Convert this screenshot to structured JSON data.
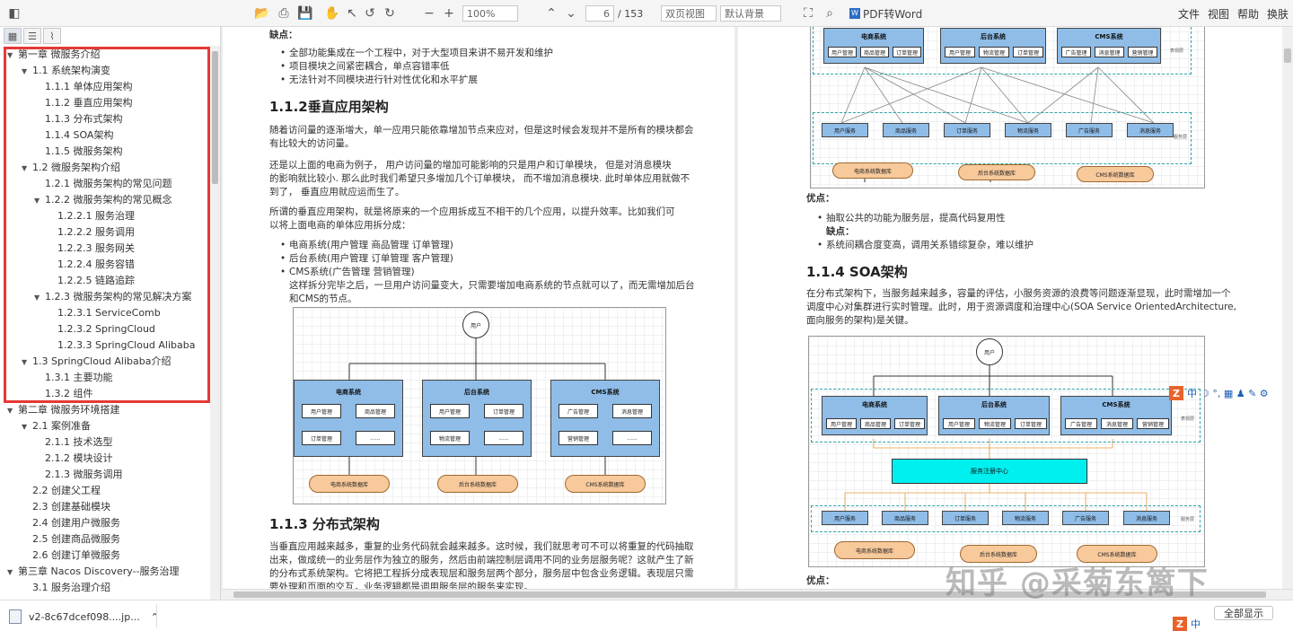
{
  "toolbar": {
    "zoom": "100%",
    "page_current": "6",
    "page_total": "/ 153",
    "view_mode": "双页视图",
    "background": "默认背景",
    "pdf_to_word": "PDF转Word",
    "menus": [
      "文件",
      "视图",
      "帮助",
      "换肤"
    ]
  },
  "sidebar": {
    "tabs": [
      "thumbnails",
      "outline",
      "attachments"
    ],
    "tree": [
      {
        "label": "第一章 微服务介绍",
        "level": 0,
        "expanded": true
      },
      {
        "label": "1.1 系统架构演变",
        "level": 1,
        "expanded": true
      },
      {
        "label": "1.1.1 单体应用架构",
        "level": 2
      },
      {
        "label": "1.1.2 垂直应用架构",
        "level": 2
      },
      {
        "label": "1.1.3 分布式架构",
        "level": 2
      },
      {
        "label": "1.1.4 SOA架构",
        "level": 2
      },
      {
        "label": "1.1.5 微服务架构",
        "level": 2
      },
      {
        "label": "1.2 微服务架构介绍",
        "level": 1,
        "expanded": true
      },
      {
        "label": "1.2.1 微服务架构的常见问题",
        "level": 2
      },
      {
        "label": "1.2.2 微服务架构的常见概念",
        "level": 2,
        "expanded": true
      },
      {
        "label": "1.2.2.1 服务治理",
        "level": 3
      },
      {
        "label": "1.2.2.2 服务调用",
        "level": 3
      },
      {
        "label": "1.2.2.3 服务网关",
        "level": 3
      },
      {
        "label": "1.2.2.4 服务容错",
        "level": 3
      },
      {
        "label": "1.2.2.5 链路追踪",
        "level": 3
      },
      {
        "label": "1.2.3 微服务架构的常见解决方案",
        "level": 2,
        "expanded": true
      },
      {
        "label": "1.2.3.1 ServiceComb",
        "level": 3
      },
      {
        "label": "1.2.3.2 SpringCloud",
        "level": 3
      },
      {
        "label": "1.2.3.3 SpringCloud Alibaba",
        "level": 3
      },
      {
        "label": "1.3 SpringCloud Alibaba介绍",
        "level": 1,
        "expanded": true
      },
      {
        "label": "1.3.1 主要功能",
        "level": 2
      },
      {
        "label": "1.3.2 组件",
        "level": 2
      },
      {
        "label": "第二章 微服务环境搭建",
        "level": 0,
        "expanded": true
      },
      {
        "label": "2.1 案例准备",
        "level": 1,
        "expanded": true
      },
      {
        "label": "2.1.1 技术选型",
        "level": 2
      },
      {
        "label": "2.1.2 模块设计",
        "level": 2
      },
      {
        "label": "2.1.3 微服务调用",
        "level": 2
      },
      {
        "label": "2.2 创建父工程",
        "level": 1
      },
      {
        "label": "2.3 创建基础模块",
        "level": 1
      },
      {
        "label": "2.4 创建用户微服务",
        "level": 1
      },
      {
        "label": "2.5 创建商品微服务",
        "level": 1
      },
      {
        "label": "2.6 创建订单微服务",
        "level": 1
      },
      {
        "label": "第三章 Nacos Discovery--服务治理",
        "level": 0,
        "expanded": true
      },
      {
        "label": "3.1 服务治理介绍",
        "level": 1
      }
    ]
  },
  "left_page": {
    "defect_label": "缺点：",
    "defects": [
      "全部功能集成在一个工程中，对于大型项目来讲不易开发和维护",
      "项目模块之间紧密耦合，单点容错率低",
      "无法针对不同模块进行针对性优化和水平扩展"
    ],
    "heading_vertical": "1.1.2垂直应用架构",
    "para1": [
      "随着访问量的逐渐增大，单一应用只能依靠增加节点来应对，但是这时候会发现并不是所有的模块都会",
      "有比较大的访问量。"
    ],
    "para2": [
      "还是以上面的电商为例子，  用户访问量的增加可能影响的只是用户和订单模块，  但是对消息模块",
      "的影响就比较小. 那么此时我们希望只多增加几个订单模块，  而不增加消息模块. 此时单体应用就做不",
      "到了，  垂直应用就应运而生了。"
    ],
    "para3": [
      "所谓的垂直应用架构，就是将原来的一个应用拆成互不相干的几个应用，以提升效率。比如我们可",
      "以将上面电商的单体应用拆分成："
    ],
    "split_items": [
      "电商系统(用户管理 商品管理 订单管理)",
      "后台系统(用户管理 订单管理 客户管理)",
      "CMS系统(广告管理 营销管理)"
    ],
    "para4": [
      "这样拆分完毕之后，一旦用户访问量变大，只需要增加电商系统的节点就可以了，而无需增加后台",
      "和CMS的节点。"
    ],
    "heading_distributed": "1.1.3 分布式架构",
    "para5": [
      "当垂直应用越来越多，重复的业务代码就会越来越多。这时候，我们就思考可不可以将重复的代码抽取",
      "出来，做成统一的业务层作为独立的服务，然后由前端控制层调用不同的业务层服务呢？这就产生了新",
      "的分布式系统架构。它将把工程拆分成表现层和服务层两个部分，服务层中包含业务逻辑。表现层只需",
      "要处理和页面的交互，业务逻辑都是调用服务层的服务来实现。"
    ],
    "diagram": {
      "user": "用户",
      "groups": [
        {
          "title": "电商系统",
          "boxes": [
            "用户管理",
            "商品管理",
            "订单管理",
            "......"
          ]
        },
        {
          "title": "后台系统",
          "boxes": [
            "用户管理",
            "订单管理",
            "物流管理",
            "......"
          ]
        },
        {
          "title": "CMS系统",
          "boxes": [
            "广告管理",
            "消息管理",
            "营销管理",
            "......"
          ]
        }
      ],
      "dbs": [
        "电商系统数据库",
        "后台系统数据库",
        "CMS系统数据库"
      ]
    }
  },
  "right_page": {
    "diagram_top": {
      "groups": [
        {
          "title": "电商系统",
          "boxes": [
            "用户管理",
            "商品管理",
            "订单管理"
          ]
        },
        {
          "title": "后台系统",
          "boxes": [
            "用户管理",
            "物流管理",
            "订单管理"
          ]
        },
        {
          "title": "CMS系统",
          "boxes": [
            "广告管理",
            "消息管理",
            "营销管理"
          ]
        }
      ],
      "layer_web": "表现层",
      "services": [
        "用户服务",
        "商品服务",
        "订单服务",
        "物流服务",
        "广告服务",
        "消息服务"
      ],
      "layer_service": "服务层",
      "dbs": [
        "电商系统数据库",
        "后台系统数据库",
        "CMS系统数据库"
      ]
    },
    "pros_label": "优点：",
    "pros": [
      "抽取公共的功能为服务层，提高代码复用性"
    ],
    "cons_label": "缺点：",
    "cons": [
      "系统间耦合度变高，调用关系错综复杂，难以维护"
    ],
    "heading_soa": "1.1.4 SOA架构",
    "para_soa": [
      "在分布式架构下，当服务越来越多，容量的评估，小服务资源的浪费等问题逐渐显现，此时需增加一个",
      "调度中心对集群进行实时管理。此时，用于资源调度和治理中心(SOA Service OrientedArchitecture,",
      "面向服务的架构)是关键。"
    ],
    "diagram_soa": {
      "user": "用户",
      "groups": [
        {
          "title": "电商系统",
          "boxes": [
            "用户管理",
            "商品管理",
            "订单管理"
          ]
        },
        {
          "title": "后台系统",
          "boxes": [
            "用户管理",
            "物流管理",
            "订单管理"
          ]
        },
        {
          "title": "CMS系统",
          "boxes": [
            "广告管理",
            "消息管理",
            "营销管理"
          ]
        }
      ],
      "layer_web": "表现层",
      "registry": "服务注册中心",
      "services": [
        "用户服务",
        "商品服务",
        "订单服务",
        "物流服务",
        "广告服务",
        "消息服务"
      ],
      "layer_service": "服务层",
      "dbs": [
        "电商系统数据库",
        "后台系统数据库",
        "CMS系统数据库"
      ]
    },
    "pros_label_bottom": "优点："
  },
  "watermark": "知乎 @采菊东篱下",
  "ime": {
    "logo": "Z",
    "mode": "中",
    "symbols": "☽ °, ▦ ♟ ✎ ⚙"
  },
  "download": {
    "filename": "v2-8c67dcef098....jp...",
    "show_all": "全部显示"
  },
  "colors": {
    "highlight": "#e53935",
    "group_blue": "#8fbde8",
    "db_orange": "#f8c99b",
    "registry_cyan": "#00f0f0",
    "dashed_teal": "#2ba3a8"
  }
}
